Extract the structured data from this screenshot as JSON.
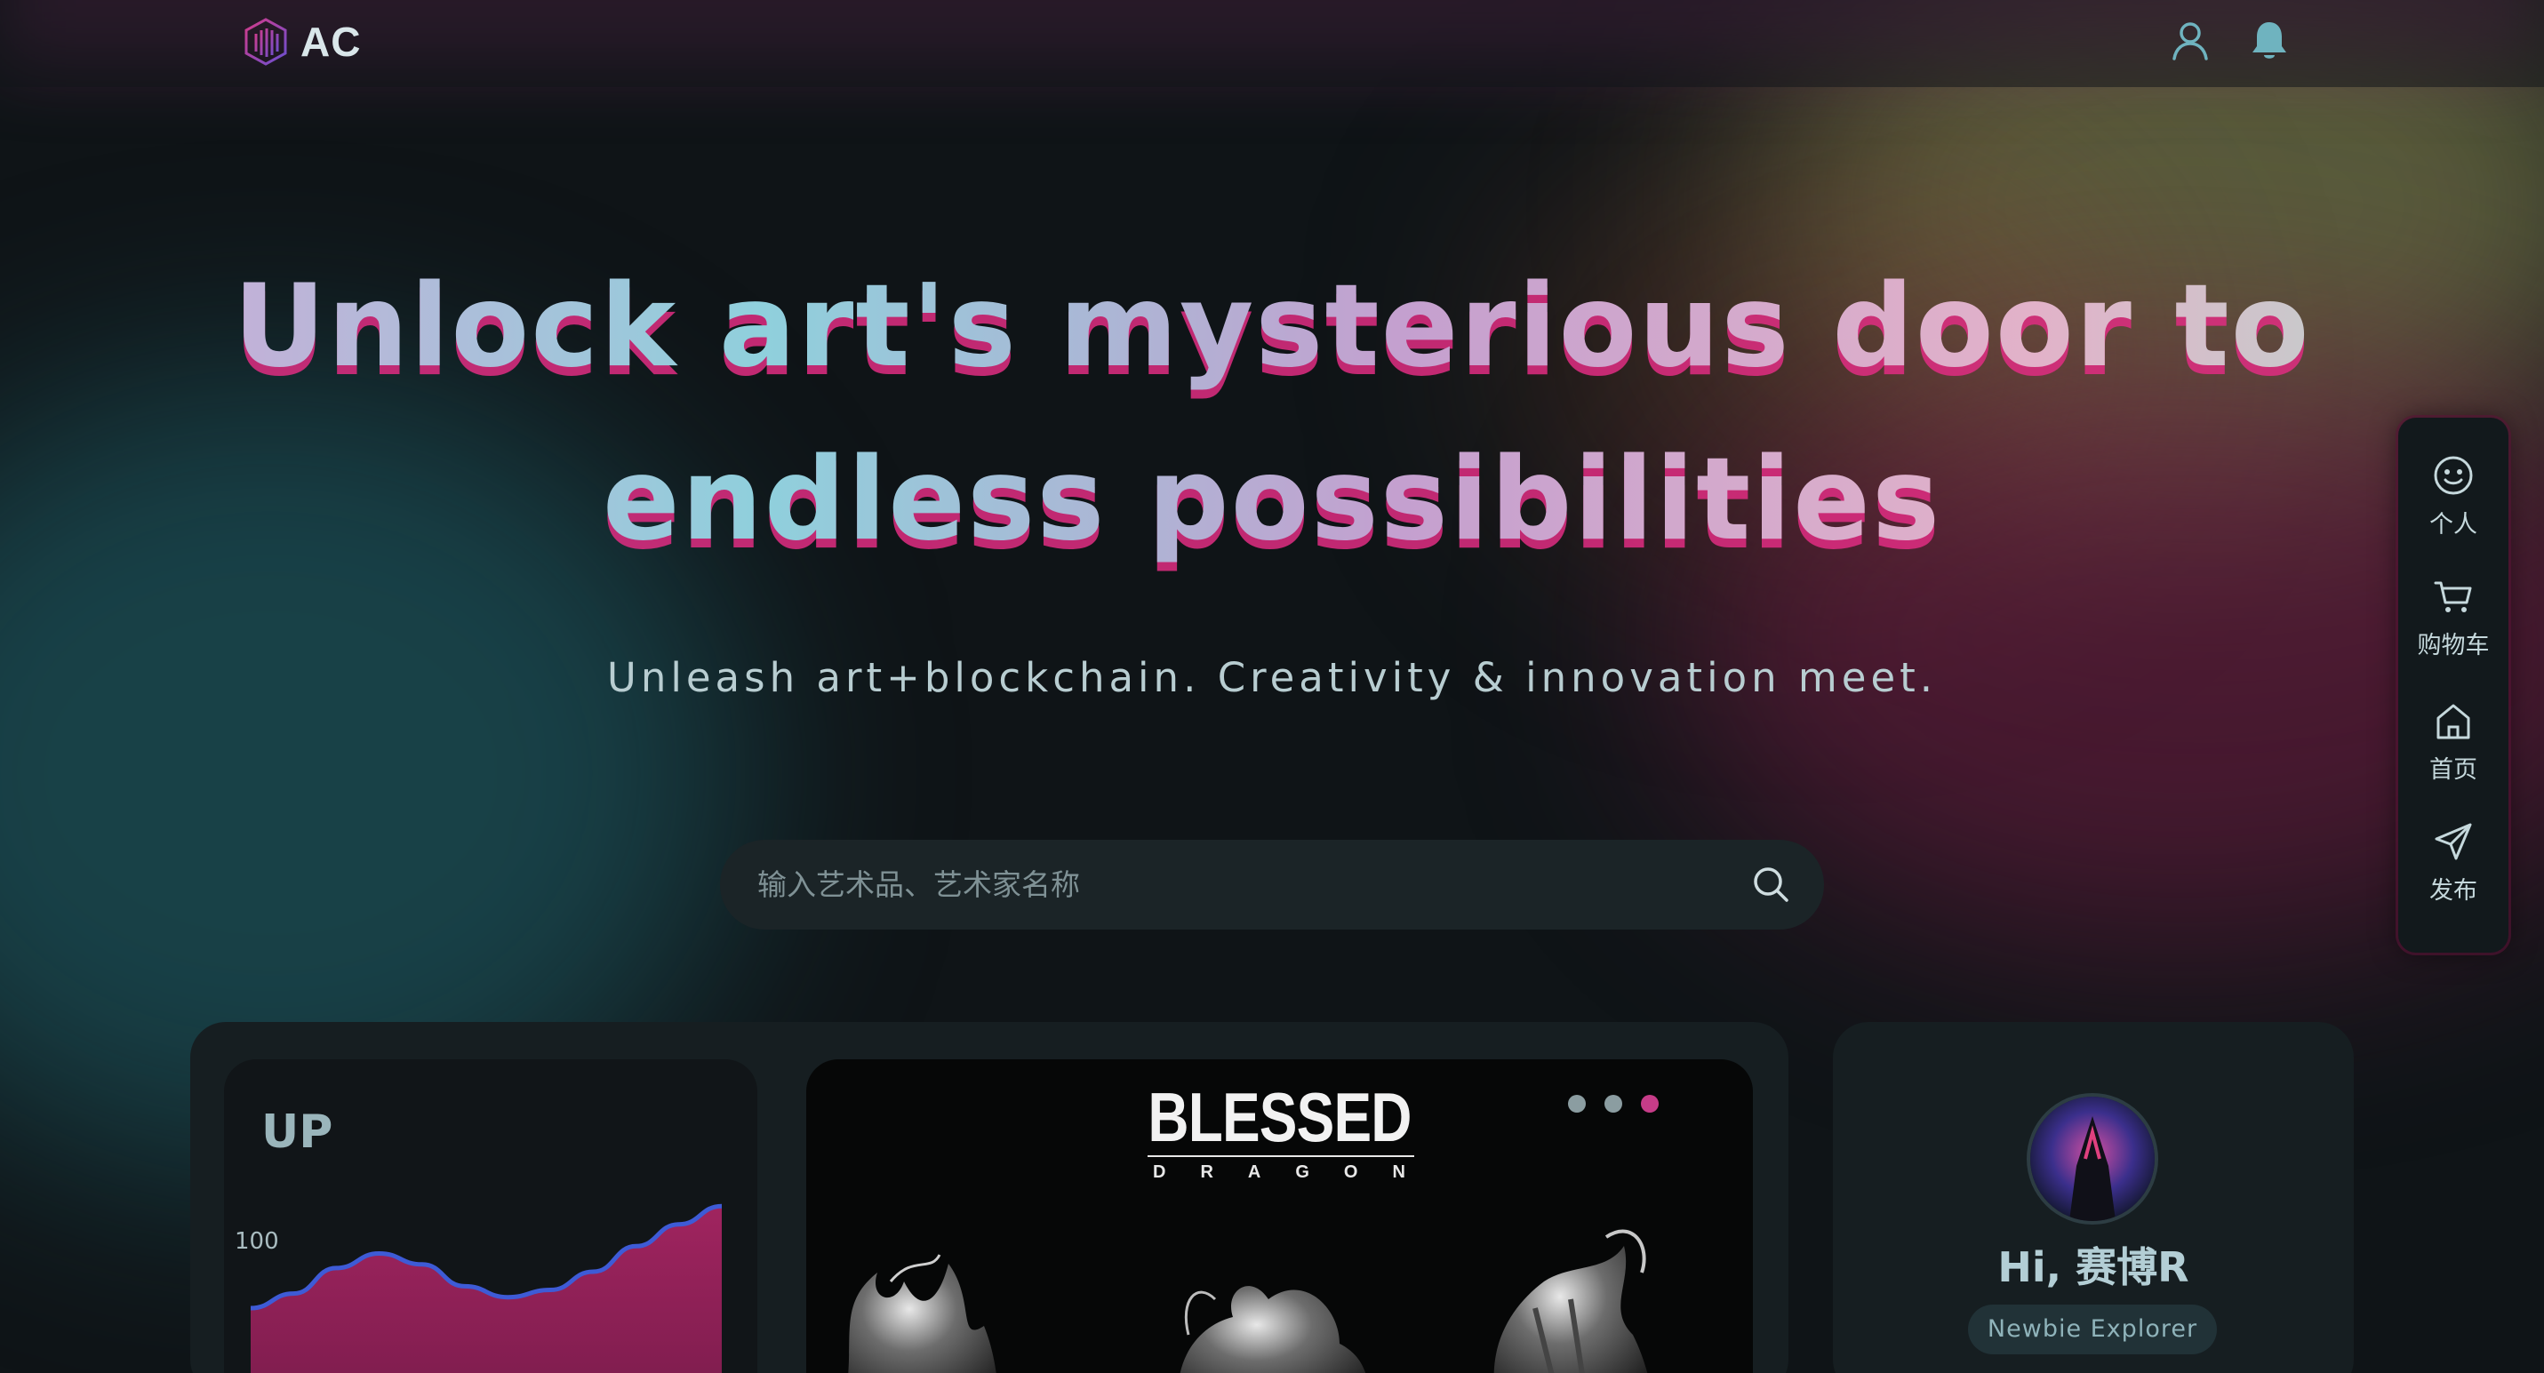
{
  "header": {
    "logo_text": "AC",
    "logo_icon": "hexagon-logo-icon",
    "user_icon": "user-icon",
    "notification_icon": "bell-icon"
  },
  "hero": {
    "title_line1": "Unlock art's mysterious door to",
    "title_line2": "endless possibilities",
    "subtitle": "Unleash art+blockchain. Creativity & innovation meet."
  },
  "search": {
    "placeholder": "输入艺术品、艺术家名称",
    "value": "",
    "icon": "search-icon"
  },
  "side_nav": {
    "items": [
      {
        "label": "个人",
        "icon": "smiley-icon"
      },
      {
        "label": "购物车",
        "icon": "cart-icon"
      },
      {
        "label": "首页",
        "icon": "home-icon"
      },
      {
        "label": "发布",
        "icon": "send-icon"
      }
    ]
  },
  "chart_card": {
    "title": "UP",
    "y_tick": "100"
  },
  "chart_data": {
    "type": "area",
    "title": "UP",
    "yticks": [
      "100"
    ],
    "series": [
      {
        "values": [
          0,
          8,
          22,
          30,
          24,
          12,
          6,
          10,
          20,
          34,
          46,
          56
        ]
      }
    ]
  },
  "banner": {
    "title": "BLESSED",
    "subtitle": "DRAGON",
    "slides": 3,
    "active_slide": 3
  },
  "profile": {
    "greeting": "Hi, 赛博R",
    "badge": "Newbie Explorer"
  },
  "colors": {
    "accent_pink": "#c63c88",
    "accent_teal": "#6fb0bb",
    "background": "#0f1417"
  }
}
